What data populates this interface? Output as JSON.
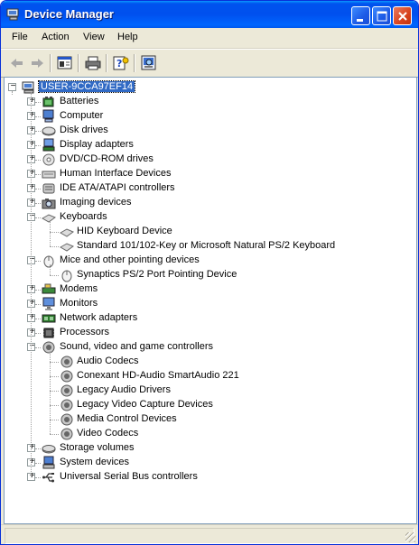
{
  "window": {
    "title": "Device Manager"
  },
  "menu": [
    "File",
    "Action",
    "View",
    "Help"
  ],
  "toolbar": {
    "icons": [
      "back-arrow-icon",
      "forward-arrow-icon",
      "properties-pane-icon",
      "print-icon",
      "help-icon",
      "scan-hardware-icon"
    ]
  },
  "tree": {
    "root": "USER-9CCA97EF14",
    "categories": [
      {
        "label": "Batteries",
        "icon": "battery-icon",
        "expanded": false,
        "children": []
      },
      {
        "label": "Computer",
        "icon": "computer-icon",
        "expanded": false,
        "children": []
      },
      {
        "label": "Disk drives",
        "icon": "disk-drive-icon",
        "expanded": false,
        "children": []
      },
      {
        "label": "Display adapters",
        "icon": "display-adapter-icon",
        "expanded": false,
        "children": []
      },
      {
        "label": "DVD/CD-ROM drives",
        "icon": "dvd-drive-icon",
        "expanded": false,
        "children": []
      },
      {
        "label": "Human Interface Devices",
        "icon": "hid-icon",
        "expanded": false,
        "children": []
      },
      {
        "label": "IDE ATA/ATAPI controllers",
        "icon": "ide-controller-icon",
        "expanded": false,
        "children": []
      },
      {
        "label": "Imaging devices",
        "icon": "imaging-device-icon",
        "expanded": false,
        "children": []
      },
      {
        "label": "Keyboards",
        "icon": "keyboard-icon",
        "expanded": true,
        "children": [
          "HID Keyboard Device",
          "Standard 101/102-Key or Microsoft Natural PS/2 Keyboard"
        ]
      },
      {
        "label": "Mice and other pointing devices",
        "icon": "mouse-icon",
        "expanded": true,
        "children": [
          "Synaptics PS/2 Port Pointing Device"
        ]
      },
      {
        "label": "Modems",
        "icon": "modem-icon",
        "expanded": false,
        "children": []
      },
      {
        "label": "Monitors",
        "icon": "monitor-icon",
        "expanded": false,
        "children": []
      },
      {
        "label": "Network adapters",
        "icon": "network-adapter-icon",
        "expanded": false,
        "children": []
      },
      {
        "label": "Processors",
        "icon": "processor-icon",
        "expanded": false,
        "children": []
      },
      {
        "label": "Sound, video and game controllers",
        "icon": "sound-icon",
        "expanded": true,
        "children": [
          "Audio Codecs",
          "Conexant HD-Audio SmartAudio 221",
          "Legacy Audio Drivers",
          "Legacy Video Capture Devices",
          "Media Control Devices",
          "Video Codecs"
        ]
      },
      {
        "label": "Storage volumes",
        "icon": "storage-volume-icon",
        "expanded": false,
        "children": []
      },
      {
        "label": "System devices",
        "icon": "system-device-icon",
        "expanded": false,
        "children": []
      },
      {
        "label": "Universal Serial Bus controllers",
        "icon": "usb-icon",
        "expanded": false,
        "children": []
      }
    ]
  },
  "colors": {
    "titlebar": "#0054e3",
    "selection": "#316ac5",
    "window_bg": "#ece9d8"
  }
}
